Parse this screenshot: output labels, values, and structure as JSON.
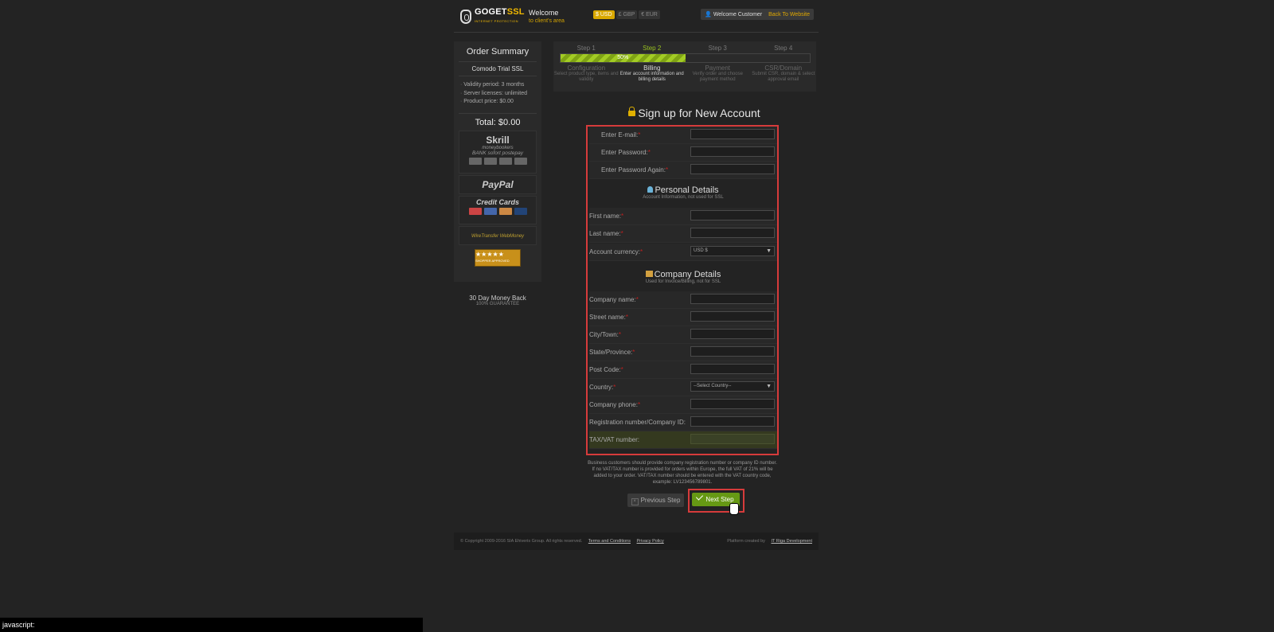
{
  "header": {
    "logo_main_left": "GOGET",
    "logo_main_right": "SSL",
    "logo_sub": "INTERNET PROTECTION",
    "welcome": "Welcome",
    "welcome_sub": "to client's area",
    "currencies": [
      "$ USD",
      "£ GBP",
      "€ EUR"
    ],
    "user_label": "Welcome Customer",
    "back_link": "Back To Website"
  },
  "sidebar": {
    "title": "Order Summary",
    "product": "Comodo Trial SSL",
    "specs": [
      "Validity period: 3 months",
      "Server licenses: unlimited",
      "Product price: $0.00"
    ],
    "total": "Total: $0.00",
    "payments": {
      "skrill": "Skrill",
      "skrill_sub": "moneybookers",
      "bank_line": "BANK  sofort  postepay",
      "paypal": "PayPal",
      "credit_cards": "Credit Cards",
      "wire": "WireTransfer  WebMoney",
      "seal_top": "★★★★★",
      "seal_sub": "SHOPPER APPROVED"
    },
    "guarantee": "30 Day Money Back",
    "guarantee_sub": "100% GUARANTEE"
  },
  "steps": {
    "labels": [
      "Step 1",
      "Step 2",
      "Step 3",
      "Step 4"
    ],
    "progress": 50,
    "progress_label": "50%",
    "items": [
      {
        "title": "Configuration",
        "desc": "Select product type, items and validity"
      },
      {
        "title": "Billing",
        "desc": "Enter account information and billing details"
      },
      {
        "title": "Payment",
        "desc": "Verify order and choose payment method"
      },
      {
        "title": "CSR/Domain",
        "desc": "Submit CSR, domain & select approval email"
      }
    ]
  },
  "form": {
    "title": "Sign up for New Account",
    "email": "Enter E-mail:",
    "password": "Enter Password:",
    "password_again": "Enter Password Again:",
    "personal_title": "Personal Details",
    "personal_sub": "Account Information, not used for SSL",
    "first_name": "First name:",
    "last_name": "Last name:",
    "account_currency": "Account currency:",
    "currency_value": "USD $",
    "company_title": "Company Details",
    "company_sub": "Used for Invoice/Billing, not for SSL",
    "company_name": "Company name:",
    "street": "Street name:",
    "city": "City/Town:",
    "state": "State/Province:",
    "post_code": "Post Code:",
    "country": "Country:",
    "country_value": "--Select Country--",
    "phone": "Company phone:",
    "reg_number": "Registration number/Company ID:",
    "vat": "TAX/VAT number:",
    "required_mark": "*",
    "note": "Business customers should provide company registration number or company ID number. If no VAT/TAX number is provided for orders within Europe, the full VAT of 21% will be added to your order. VAT/TAX number should be entered with the VAT country code, example: LV123456789801."
  },
  "buttons": {
    "prev": "Previous Step",
    "next": "Next Step"
  },
  "footer": {
    "copyright": "© Copyright 2009-2016 SIA Ehiveris Group. All rights reserved.",
    "terms": "Terms and Conditions",
    "privacy": "Privacy Policy",
    "created": "Platform created by",
    "created_link": "IT Riga Development"
  },
  "status_bar": "javascript:"
}
